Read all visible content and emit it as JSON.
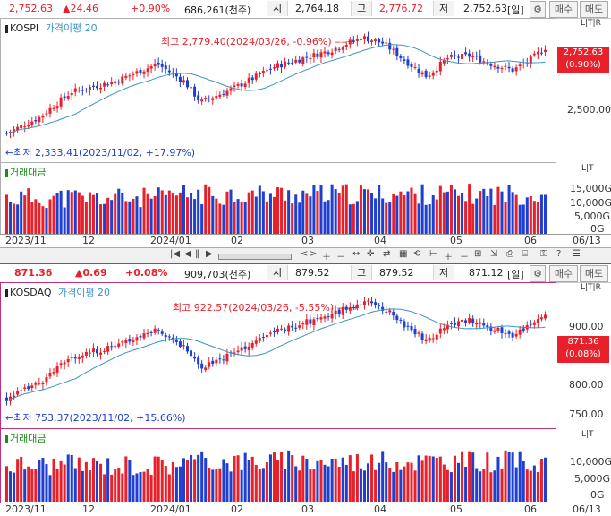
{
  "kospi": {
    "info": {
      "price": "2,752.63",
      "change": "▲24.46",
      "change_pct": "+0.90%",
      "volume": "686,261(천주)",
      "open_label": "시",
      "open": "2,764.18",
      "high_label": "고",
      "high": "2,776.72",
      "low_label": "저",
      "low": "2,752.63",
      "period": "[일]",
      "buy": "매수",
      "sell": "매도"
    },
    "name": "KOSPI",
    "ma_label": "가격이평 20",
    "high_annot": "최고 2,779.40(2024/03/26, -0.96%)",
    "low_annot": "최저 2,333.41(2023/11/02, +17.97%)",
    "price_axis": [
      "2,500.00"
    ],
    "last_price": "2,752.63",
    "last_pct": "(0.90%)",
    "volume_label": "거래대금",
    "volume_axis": [
      "15,000G",
      "10,000G",
      "5,000G",
      "0G"
    ]
  },
  "kosdaq": {
    "info": {
      "price": "871.36",
      "change": "▲0.69",
      "change_pct": "+0.08%",
      "volume": "909,703(천주)",
      "open_label": "시",
      "open": "879.52",
      "high_label": "고",
      "high": "879.52",
      "low_label": "저",
      "low": "871.12",
      "period": "[일]",
      "buy": "매수",
      "sell": "매도"
    },
    "name": "KOSDAQ",
    "ma_label": "가격이평 20",
    "high_annot": "최고 922.57(2024/03/26, -5.55%)",
    "low_annot": "최저 753.37(2023/11/02, +15.66%)",
    "price_axis": [
      "900.00",
      "800.00",
      "750.00"
    ],
    "last_price": "871.36",
    "last_pct": "(0.08%)",
    "volume_label": "거래대금",
    "volume_axis": [
      "10,000G",
      "5,000G",
      "0G"
    ]
  },
  "time_axis": [
    "2023/11",
    "12",
    "2024/01",
    "02",
    "03",
    "04",
    "05",
    "06",
    "06/13"
  ],
  "panel_tags": {
    "ltr": "L|T|R",
    "lt": "L|T"
  },
  "colors": {
    "up": "#e8202a",
    "down": "#1f3fd0",
    "ma": "#3a93c8",
    "kosdaq_border": "#c0307a"
  },
  "chart_data": [
    {
      "type": "candlestick",
      "title": "KOSPI",
      "series": [
        {
          "name": "가격이평 20"
        }
      ],
      "ylim": [
        2300,
        2800
      ],
      "ticks": [
        "2,500.00"
      ],
      "high": {
        "value": 2779.4,
        "date": "2024/03/26"
      },
      "low": {
        "value": 2333.41,
        "date": "2023/11/02"
      },
      "last": 2752.63
    },
    {
      "type": "bar",
      "title": "거래대금",
      "ticks": [
        "15,000G",
        "10,000G",
        "5,000G",
        "0G"
      ],
      "ylim": [
        0,
        18000
      ]
    },
    {
      "type": "candlestick",
      "title": "KOSDAQ",
      "series": [
        {
          "name": "가격이평 20"
        }
      ],
      "ylim": [
        740,
        935
      ],
      "ticks": [
        "900.00",
        "800.00",
        "750.00"
      ],
      "high": {
        "value": 922.57,
        "date": "2024/03/26"
      },
      "low": {
        "value": 753.37,
        "date": "2023/11/02"
      },
      "last": 871.36
    },
    {
      "type": "bar",
      "title": "거래대금",
      "ticks": [
        "10,000G",
        "5,000G",
        "0G"
      ],
      "ylim": [
        0,
        13000
      ]
    }
  ]
}
